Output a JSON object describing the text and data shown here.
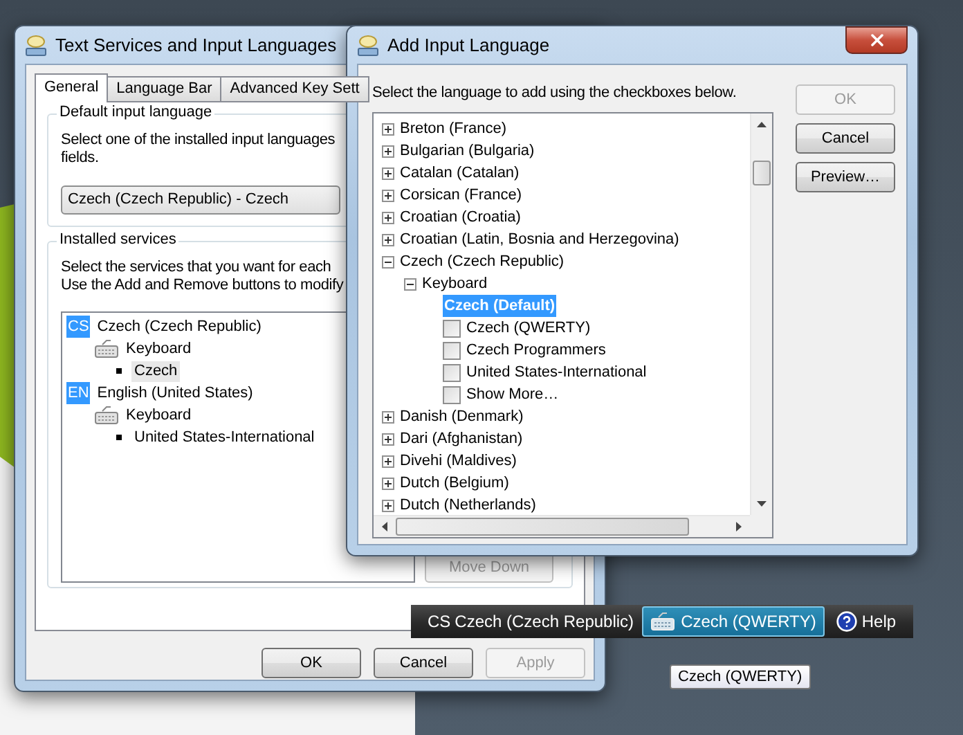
{
  "text_services_window": {
    "title": "Text Services and Input Languages",
    "tabs": [
      {
        "label": "General",
        "selected": true
      },
      {
        "label": "Language Bar",
        "selected": false
      },
      {
        "label": "Advanced Key Sett",
        "selected": false
      }
    ],
    "default_input_language": {
      "heading": "Default input language",
      "description": [
        "Select one of the installed input languages",
        "fields."
      ],
      "value": "Czech (Czech Republic) - Czech"
    },
    "installed_services": {
      "heading": "Installed services",
      "description": [
        "Select the services that you want for each",
        "Use the Add and Remove buttons to modify"
      ],
      "languages": [
        {
          "code": "CS",
          "label": "Czech (Czech Republic)",
          "children": [
            {
              "label": "Keyboard",
              "children": [
                {
                  "label": "Czech",
                  "selected": true
                }
              ]
            }
          ]
        },
        {
          "code": "EN",
          "label": "English (United States)",
          "children": [
            {
              "label": "Keyboard",
              "children": [
                {
                  "label": "United States-International",
                  "selected": false
                }
              ]
            }
          ]
        }
      ],
      "buttons": [
        {
          "label": "Move Down",
          "disabled": true
        }
      ]
    },
    "buttons": [
      {
        "label": "OK",
        "disabled": false
      },
      {
        "label": "Cancel",
        "disabled": false
      },
      {
        "label": "Apply",
        "disabled": true
      }
    ]
  },
  "add_language_window": {
    "title": "Add Input Language",
    "instruction": "Select the language to add using the checkboxes below.",
    "tree": [
      {
        "label": "Breton (France)",
        "expanded": false,
        "selected": false
      },
      {
        "label": "Bulgarian (Bulgaria)",
        "expanded": false,
        "selected": false
      },
      {
        "label": "Catalan (Catalan)",
        "expanded": false,
        "selected": false
      },
      {
        "label": "Corsican (France)",
        "expanded": false,
        "selected": false
      },
      {
        "label": "Croatian (Croatia)",
        "expanded": false,
        "selected": false
      },
      {
        "label": "Croatian (Latin, Bosnia and Herzegovina)",
        "expanded": false,
        "selected": false
      },
      {
        "label": "Czech (Czech Republic)",
        "expanded": true,
        "selected": false,
        "children": [
          {
            "label": "Keyboard",
            "expanded": true,
            "selected": false,
            "children": [
              {
                "label": "Czech (Default)",
                "kind": "default",
                "selected": true
              },
              {
                "label": "Czech (QWERTY)",
                "kind": "checkbox",
                "checked": false,
                "selected": false
              },
              {
                "label": "Czech Programmers",
                "kind": "checkbox",
                "checked": false,
                "selected": false
              },
              {
                "label": "United States-International",
                "kind": "checkbox",
                "checked": false,
                "selected": false
              },
              {
                "label": "Show More…",
                "kind": "checkbox",
                "checked": false,
                "selected": false
              }
            ]
          }
        ]
      },
      {
        "label": "Danish (Denmark)",
        "expanded": false,
        "selected": false
      },
      {
        "label": "Dari (Afghanistan)",
        "expanded": false,
        "selected": false
      },
      {
        "label": "Divehi (Maldives)",
        "expanded": false,
        "selected": false
      },
      {
        "label": "Dutch (Belgium)",
        "expanded": false,
        "selected": false
      },
      {
        "label": "Dutch (Netherlands)",
        "expanded": false,
        "selected": false
      }
    ],
    "buttons": [
      {
        "label": "OK",
        "disabled": true
      },
      {
        "label": "Cancel",
        "disabled": false
      },
      {
        "label": "Preview…",
        "disabled": false
      }
    ]
  },
  "language_bar": {
    "code": "CS",
    "language": "Czech (Czech Republic)",
    "keyboard": {
      "label": "Czech (QWERTY)",
      "active": true
    },
    "help": "Help"
  },
  "tooltip": "Czech (QWERTY)"
}
